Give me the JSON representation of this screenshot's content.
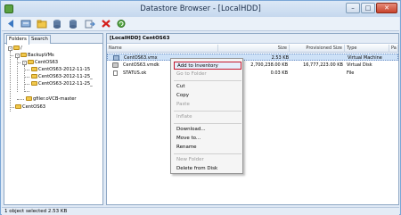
{
  "window": {
    "title": "Datastore Browser - [LocalHDD]"
  },
  "toolbar": {
    "buttons": [
      "back-icon",
      "browse-datastore-icon",
      "new-folder-icon",
      "upload-icon",
      "download-icon",
      "move-icon",
      "delete-icon",
      "refresh-icon"
    ]
  },
  "left": {
    "tabs": [
      "Folders",
      "Search"
    ],
    "tree": {
      "root": "/",
      "backup": "BackupVMs",
      "c563": "CentOS63",
      "n1": "CentOS63-2012-11-15",
      "n2": "CentOS63-2012-11-25_",
      "n3": "CentOS63-2012-11-25_",
      "gfiler": "gfiler.oVCB-master",
      "centos63": "CentOS63"
    }
  },
  "right": {
    "path": "[LocalHDD] CentOS63",
    "columns": {
      "name": "Name",
      "size": "Size",
      "prov": "Provisioned Size",
      "type": "Type",
      "more": "Pa"
    },
    "rows": [
      {
        "name": "CentOS63.vmx",
        "size": "2.53 KB",
        "prov": "",
        "type": "Virtual Machine"
      },
      {
        "name": "CentOS63.vmdk",
        "size": "2,700,238.00 KB",
        "prov": "16,777,223.00 KB",
        "type": "Virtual Disk"
      },
      {
        "name": "STATUS.ok",
        "size": "0.03 KB",
        "prov": "",
        "type": "File"
      }
    ]
  },
  "context_menu": {
    "items": [
      {
        "label": "Add to Inventory",
        "state": "highlighted"
      },
      {
        "label": "Go to Folder",
        "state": "disabled"
      },
      {
        "label": "Cut",
        "state": "enabled"
      },
      {
        "label": "Copy",
        "state": "enabled"
      },
      {
        "label": "Paste",
        "state": "disabled"
      },
      {
        "label": "Inflate",
        "state": "disabled"
      },
      {
        "label": "Download...",
        "state": "enabled"
      },
      {
        "label": "Move to...",
        "state": "enabled"
      },
      {
        "label": "Rename",
        "state": "enabled"
      },
      {
        "label": "New Folder",
        "state": "disabled"
      },
      {
        "label": "Delete from Disk",
        "state": "enabled"
      }
    ]
  },
  "status": {
    "text": "1 object selected 2.53 KB"
  },
  "colors": {
    "highlight_border": "#c4182e",
    "selection": "#cde1f7",
    "delete_icon": "#d4201c"
  }
}
